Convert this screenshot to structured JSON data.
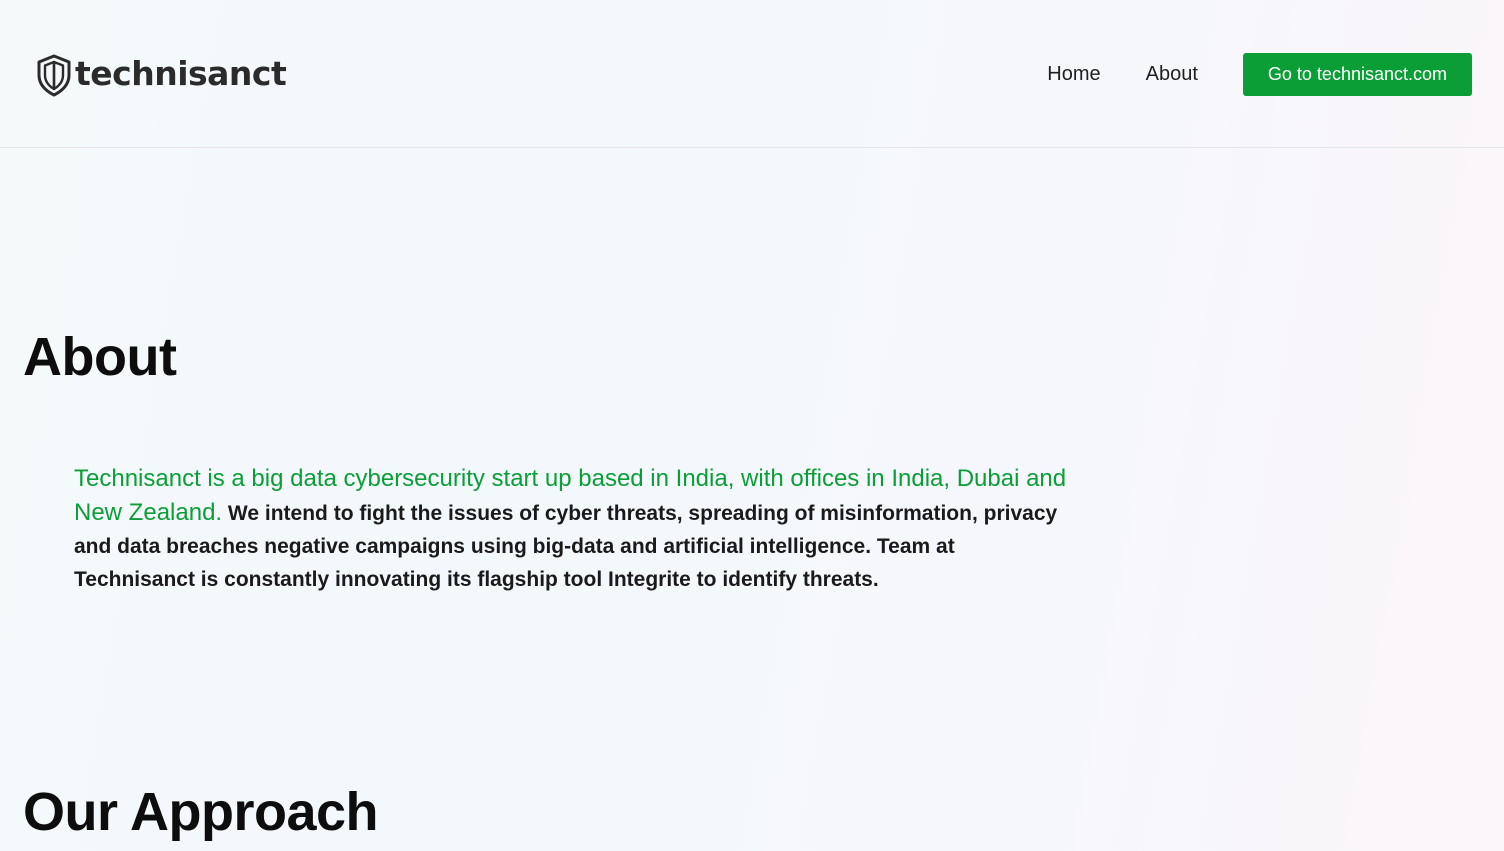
{
  "header": {
    "logo": {
      "icon": "shield-icon",
      "text": "technisanct"
    },
    "nav": {
      "home": "Home",
      "about": "About"
    },
    "cta_label": "Go to technisanct.com"
  },
  "about": {
    "title": "About",
    "highlight": "Technisanct is a big data cybersecurity start up based in India, with offices in India, Dubai and New Zealand.",
    "body": "We intend to fight the issues of cyber threats, spreading of misinformation, privacy and data breaches negative campaigns using big-data and artificial intelligence. Team at Technisanct is constantly innovating its flagship tool Integrite to identify threats."
  },
  "approach": {
    "title": "Our Approach"
  },
  "colors": {
    "accent": "#0b9e37",
    "text": "#111111"
  }
}
